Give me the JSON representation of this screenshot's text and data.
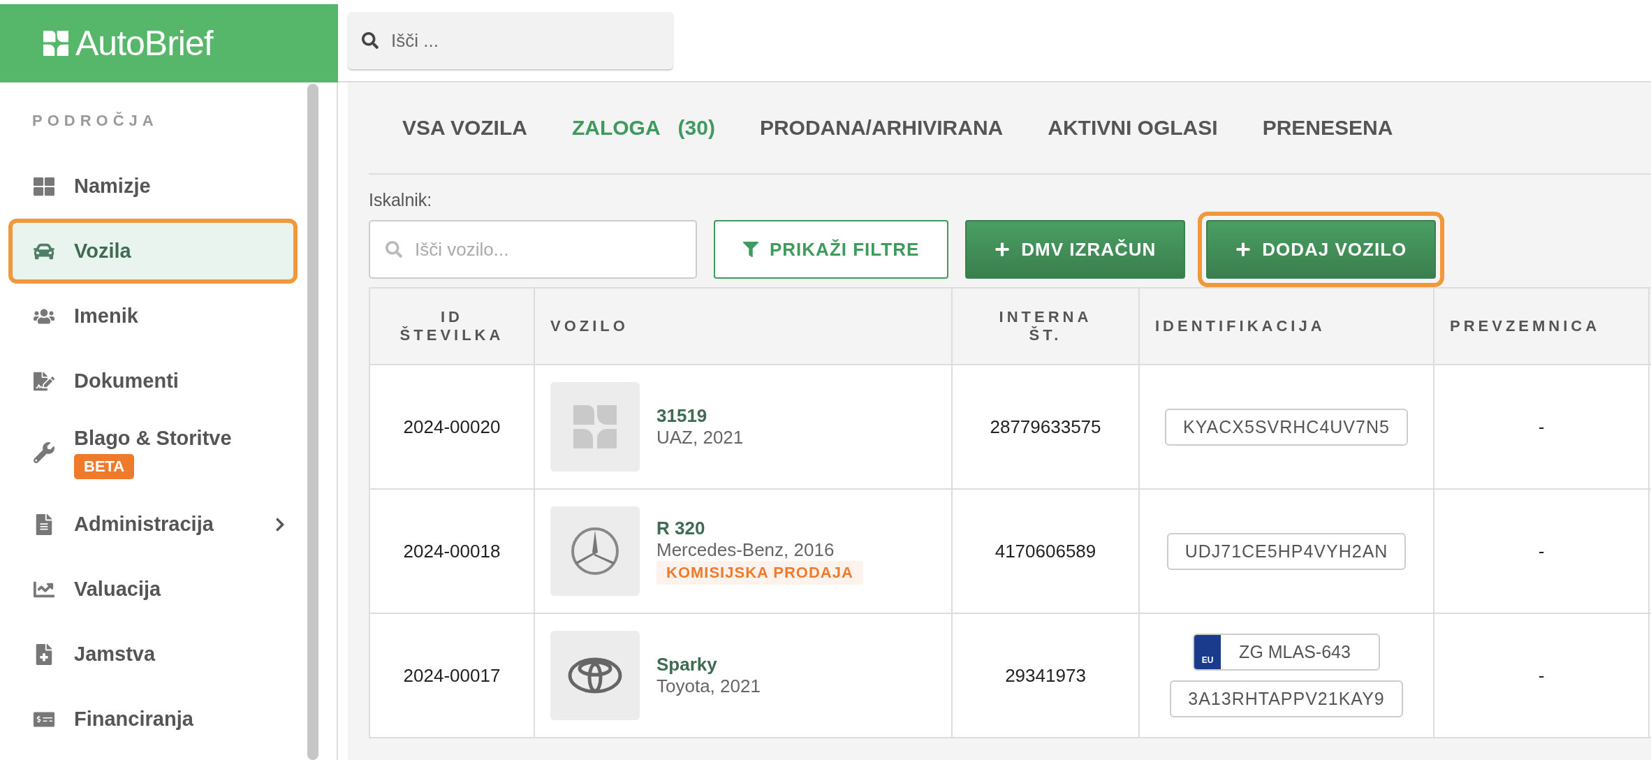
{
  "header": {
    "logo": "AutoBrief",
    "search": {
      "placeholder": "Išči ..."
    }
  },
  "sidebar": {
    "section": "PODROČJA",
    "items": [
      {
        "label": "Namizje",
        "selected": false,
        "highlighted": false
      },
      {
        "label": "Vozila",
        "selected": true,
        "highlighted": true
      },
      {
        "label": "Imenik",
        "selected": false,
        "highlighted": false
      },
      {
        "label": "Dokumenti",
        "selected": false,
        "highlighted": false
      },
      {
        "label": "Blago & Storitve",
        "badge": "BETA",
        "selected": false,
        "highlighted": false
      },
      {
        "label": "Administracija",
        "expanded": false,
        "selected": false,
        "highlighted": false
      },
      {
        "label": "Valuacija",
        "selected": false,
        "highlighted": false
      },
      {
        "label": "Jamstva",
        "selected": false,
        "highlighted": false
      },
      {
        "label": "Financiranja",
        "selected": false,
        "highlighted": false
      }
    ]
  },
  "tabs": [
    {
      "label": "VSA VOZILA",
      "selected": false
    },
    {
      "label": "ZALOGA",
      "count": "(30)",
      "selected": true
    },
    {
      "label": "PRODANA/ARHIVIRANA",
      "selected": false
    },
    {
      "label": "AKTIVNI OGLASI",
      "selected": false
    },
    {
      "label": "PRENESENA",
      "selected": false
    }
  ],
  "search_label": "Iskalnik:",
  "search": {
    "placeholder": "Išči vozilo..."
  },
  "buttons": [
    {
      "label": "PRIKAŽI FILTRE",
      "kind": "outline",
      "highlighted": false
    },
    {
      "label": "DMV IZRAČUN",
      "kind": "primary",
      "highlighted": false
    },
    {
      "label": "DODAJ VOZILO",
      "kind": "primary",
      "highlighted": true
    }
  ],
  "table": {
    "columns": [
      [
        "ID",
        "ŠTEVILKA"
      ],
      [
        "VOZILO"
      ],
      [
        "INTERNA",
        "ŠT."
      ],
      [
        "IDENTIFIKACIJA"
      ],
      [
        "PREVZEMNICA"
      ]
    ],
    "rows": [
      {
        "id": "2024-00020",
        "kind": "placeholder",
        "model": "31519",
        "make_year": "UAZ, 2021",
        "internal": "28779633575",
        "identifiers": [
          {
            "kind": "vin",
            "text": "KYACX5SVRHC4UV7N5"
          }
        ],
        "prevzemnica": "-"
      },
      {
        "id": "2024-00018",
        "kind": "star",
        "model": "R 320",
        "make_year": "Mercedes-Benz, 2016",
        "tag": "KOMISIJSKA PRODAJA",
        "internal": "4170606589",
        "identifiers": [
          {
            "kind": "vin",
            "text": "UDJ71CE5HP4VYH2AN"
          }
        ],
        "prevzemnica": "-"
      },
      {
        "id": "2024-00017",
        "kind": "ellipses",
        "model": "Sparky",
        "make_year": "Toyota, 2021",
        "internal": "29341973",
        "identifiers": [
          {
            "kind": "plate",
            "region": "EU",
            "text": "ZG MLAS-643"
          },
          {
            "kind": "vin",
            "text": "3A13RHTAPPV21KAY9"
          }
        ],
        "prevzemnica": "-"
      }
    ]
  }
}
